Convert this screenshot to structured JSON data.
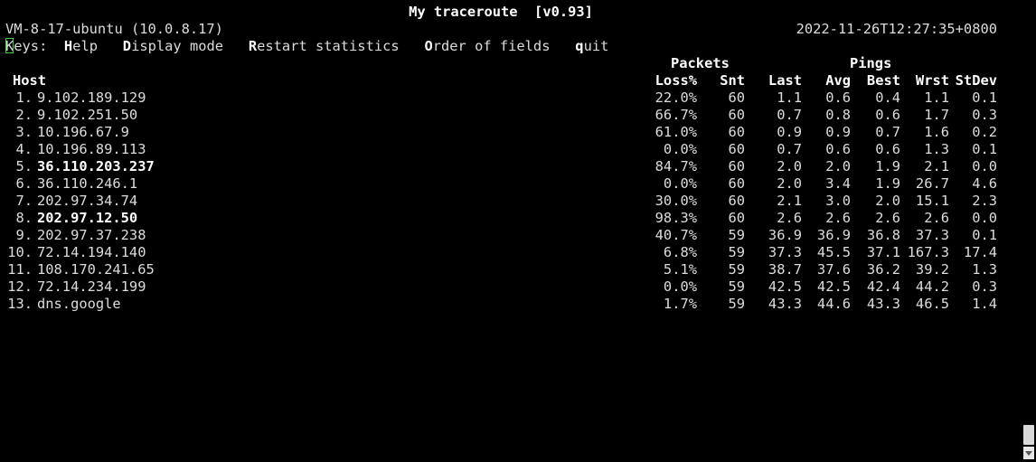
{
  "title": "My traceroute  [v0.93]",
  "host_info": "VM-8-17-ubuntu (10.0.8.17)",
  "datetime": "2022-11-26T12:27:35+0800",
  "keys": {
    "label": "Keys:",
    "items": [
      {
        "key": "H",
        "rest": "elp"
      },
      {
        "key": "D",
        "rest": "isplay mode"
      },
      {
        "key": "R",
        "rest": "estart statistics"
      },
      {
        "key": "O",
        "rest": "rder of fields"
      },
      {
        "key": "q",
        "rest": "uit"
      }
    ]
  },
  "groups": {
    "packets": "Packets",
    "pings": "Pings"
  },
  "columns": {
    "host": "Host",
    "loss": "Loss%",
    "snt": "Snt",
    "last": "Last",
    "avg": "Avg",
    "best": "Best",
    "wrst": "Wrst",
    "stdev": "StDev"
  },
  "rows": [
    {
      "n": "1.",
      "host": "9.102.189.129",
      "bold": false,
      "loss": "22.0%",
      "snt": "60",
      "last": "1.1",
      "avg": "0.6",
      "best": "0.4",
      "wrst": "1.1",
      "stdev": "0.1"
    },
    {
      "n": "2.",
      "host": "9.102.251.50",
      "bold": false,
      "loss": "66.7%",
      "snt": "60",
      "last": "0.7",
      "avg": "0.8",
      "best": "0.6",
      "wrst": "1.7",
      "stdev": "0.3"
    },
    {
      "n": "3.",
      "host": "10.196.67.9",
      "bold": false,
      "loss": "61.0%",
      "snt": "60",
      "last": "0.9",
      "avg": "0.9",
      "best": "0.7",
      "wrst": "1.6",
      "stdev": "0.2"
    },
    {
      "n": "4.",
      "host": "10.196.89.113",
      "bold": false,
      "loss": "0.0%",
      "snt": "60",
      "last": "0.7",
      "avg": "0.6",
      "best": "0.6",
      "wrst": "1.3",
      "stdev": "0.1"
    },
    {
      "n": "5.",
      "host": "36.110.203.237",
      "bold": true,
      "loss": "84.7%",
      "snt": "60",
      "last": "2.0",
      "avg": "2.0",
      "best": "1.9",
      "wrst": "2.1",
      "stdev": "0.0"
    },
    {
      "n": "6.",
      "host": "36.110.246.1",
      "bold": false,
      "loss": "0.0%",
      "snt": "60",
      "last": "2.0",
      "avg": "3.4",
      "best": "1.9",
      "wrst": "26.7",
      "stdev": "4.6"
    },
    {
      "n": "7.",
      "host": "202.97.34.74",
      "bold": false,
      "loss": "30.0%",
      "snt": "60",
      "last": "2.1",
      "avg": "3.0",
      "best": "2.0",
      "wrst": "15.1",
      "stdev": "2.3"
    },
    {
      "n": "8.",
      "host": "202.97.12.50",
      "bold": true,
      "loss": "98.3%",
      "snt": "60",
      "last": "2.6",
      "avg": "2.6",
      "best": "2.6",
      "wrst": "2.6",
      "stdev": "0.0"
    },
    {
      "n": "9.",
      "host": "202.97.37.238",
      "bold": false,
      "loss": "40.7%",
      "snt": "59",
      "last": "36.9",
      "avg": "36.9",
      "best": "36.8",
      "wrst": "37.3",
      "stdev": "0.1"
    },
    {
      "n": "10.",
      "host": "72.14.194.140",
      "bold": false,
      "loss": "6.8%",
      "snt": "59",
      "last": "37.3",
      "avg": "45.5",
      "best": "37.1",
      "wrst": "167.3",
      "stdev": "17.4"
    },
    {
      "n": "11.",
      "host": "108.170.241.65",
      "bold": false,
      "loss": "5.1%",
      "snt": "59",
      "last": "38.7",
      "avg": "37.6",
      "best": "36.2",
      "wrst": "39.2",
      "stdev": "1.3"
    },
    {
      "n": "12.",
      "host": "72.14.234.199",
      "bold": false,
      "loss": "0.0%",
      "snt": "59",
      "last": "42.5",
      "avg": "42.5",
      "best": "42.4",
      "wrst": "44.2",
      "stdev": "0.3"
    },
    {
      "n": "13.",
      "host": "dns.google",
      "bold": false,
      "loss": "1.7%",
      "snt": "59",
      "last": "43.3",
      "avg": "44.6",
      "best": "43.3",
      "wrst": "46.5",
      "stdev": "1.4"
    }
  ],
  "colors": {
    "background": "#000000",
    "text": "#dcdcdc",
    "bold": "#ffffff",
    "cursor": "#3cd03c"
  }
}
